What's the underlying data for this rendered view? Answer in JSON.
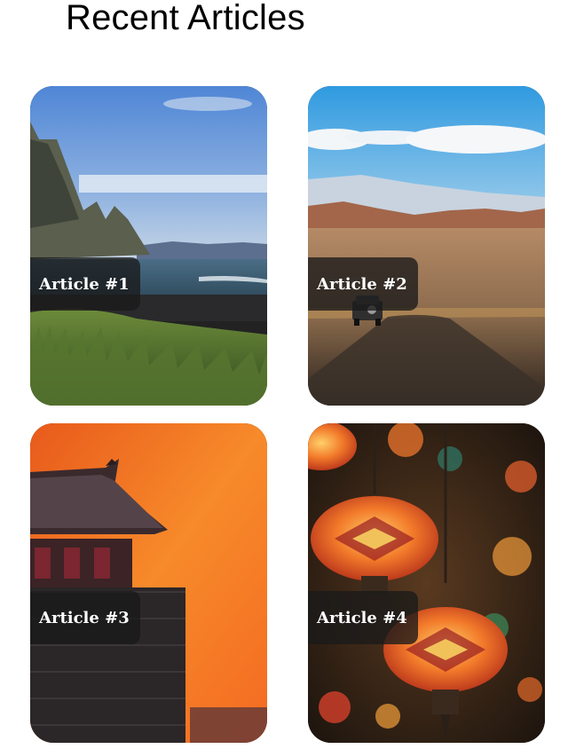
{
  "header": {
    "title": "Recent Articles"
  },
  "articles": [
    {
      "label": "Article #1",
      "scene": "coastal-mountains-beach"
    },
    {
      "label": "Article #2",
      "scene": "desert-road-car"
    },
    {
      "label": "Article #3",
      "scene": "pagoda-sunset"
    },
    {
      "label": "Article #4",
      "scene": "mosaic-lanterns"
    }
  ]
}
